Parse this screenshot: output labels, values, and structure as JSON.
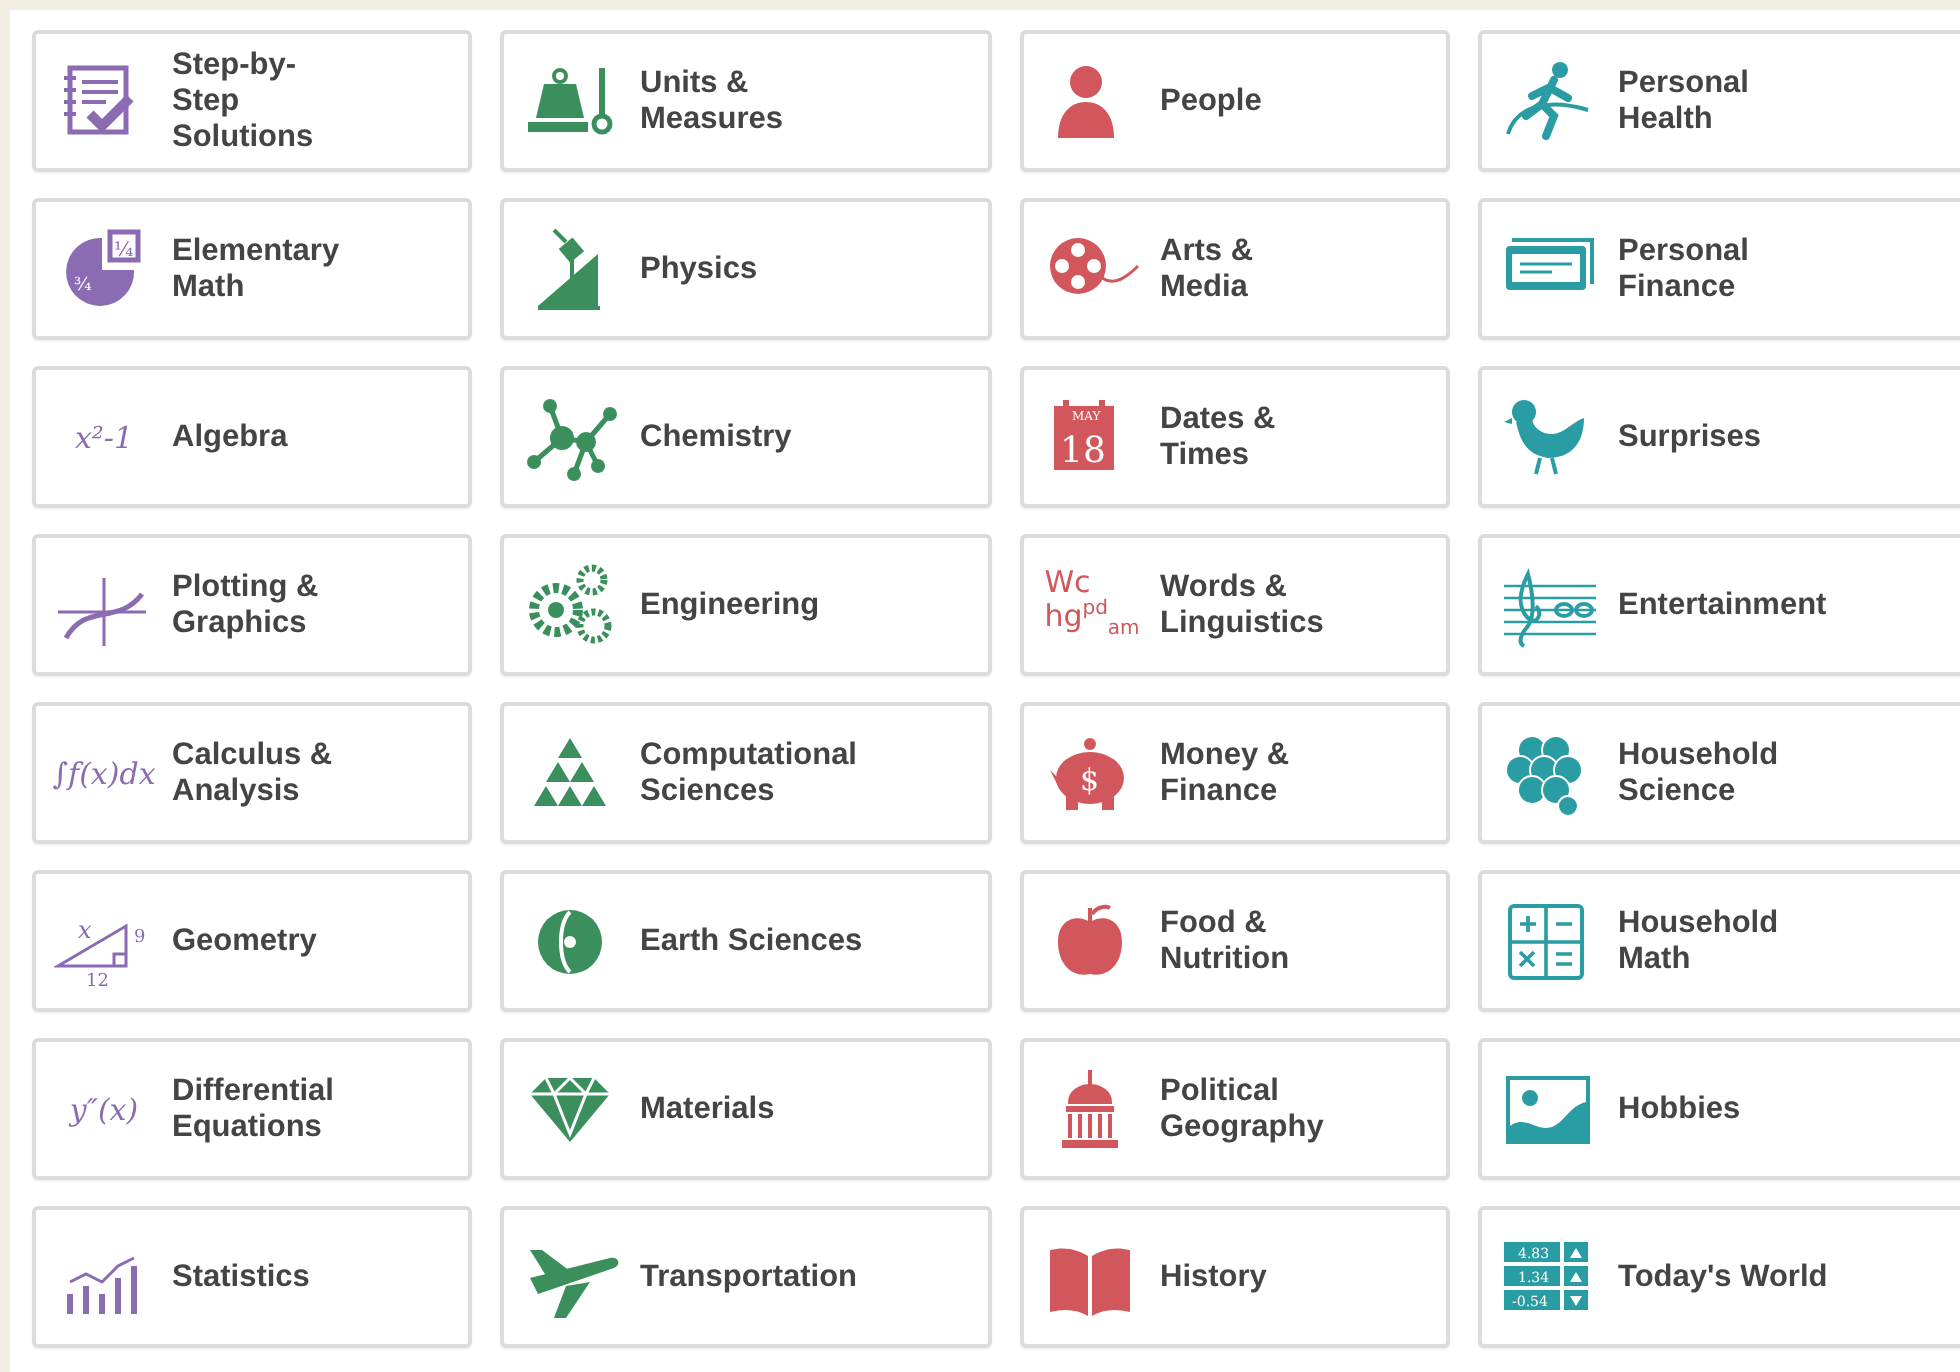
{
  "subjects": [
    {
      "label": "Step-by-\nStep\nSolutions",
      "color": "#8b6bb1"
    },
    {
      "label": "Units &\nMeasures",
      "color": "#3a8f5c"
    },
    {
      "label": "People",
      "color": "#d2575c"
    },
    {
      "label": "Personal\nHealth",
      "color": "#2a9ca3"
    },
    {
      "label": "Elementary\nMath",
      "color": "#8b6bb1",
      "glyphs": [
        "¼",
        "¾"
      ]
    },
    {
      "label": "Physics",
      "color": "#3a8f5c"
    },
    {
      "label": "Arts &\nMedia",
      "color": "#d2575c"
    },
    {
      "label": "Personal\nFinance",
      "color": "#2a9ca3"
    },
    {
      "label": "Algebra",
      "color": "#8b6bb1",
      "glyphs": [
        "x²-1"
      ]
    },
    {
      "label": "Chemistry",
      "color": "#3a8f5c"
    },
    {
      "label": "Dates &\nTimes",
      "color": "#d2575c",
      "glyphs": [
        "MAY",
        "18"
      ]
    },
    {
      "label": "Surprises",
      "color": "#2a9ca3"
    },
    {
      "label": "Plotting &\nGraphics",
      "color": "#8b6bb1"
    },
    {
      "label": "Engineering",
      "color": "#3a8f5c"
    },
    {
      "label": "Words &\nLinguistics",
      "color": "#d2575c",
      "glyphs": [
        "Wc",
        "hg",
        "pd",
        "am"
      ]
    },
    {
      "label": "Entertainment",
      "color": "#2a9ca3"
    },
    {
      "label": "Calculus &\nAnalysis",
      "color": "#8b6bb1",
      "glyphs": [
        "∫f(x)dx"
      ]
    },
    {
      "label": "Computational\nSciences",
      "color": "#3a8f5c"
    },
    {
      "label": "Money &\nFinance",
      "color": "#d2575c",
      "glyphs": [
        "$"
      ]
    },
    {
      "label": "Household\nScience",
      "color": "#2a9ca3"
    },
    {
      "label": "Geometry",
      "color": "#8b6bb1",
      "glyphs": [
        "x",
        "9",
        "12"
      ]
    },
    {
      "label": "Earth Sciences",
      "color": "#3a8f5c"
    },
    {
      "label": "Food &\nNutrition",
      "color": "#d2575c"
    },
    {
      "label": "Household\nMath",
      "color": "#2a9ca3"
    },
    {
      "label": "Differential\nEquations",
      "color": "#8b6bb1",
      "glyphs": [
        "y″(x)"
      ]
    },
    {
      "label": "Materials",
      "color": "#3a8f5c"
    },
    {
      "label": "Political\nGeography",
      "color": "#d2575c"
    },
    {
      "label": "Hobbies",
      "color": "#2a9ca3"
    },
    {
      "label": "Statistics",
      "color": "#8b6bb1"
    },
    {
      "label": "Transportation",
      "color": "#3a8f5c"
    },
    {
      "label": "History",
      "color": "#d2575c"
    },
    {
      "label": "Today's World",
      "color": "#2a9ca3",
      "glyphs": [
        "4.83",
        "1.34",
        "-0.54"
      ]
    }
  ]
}
